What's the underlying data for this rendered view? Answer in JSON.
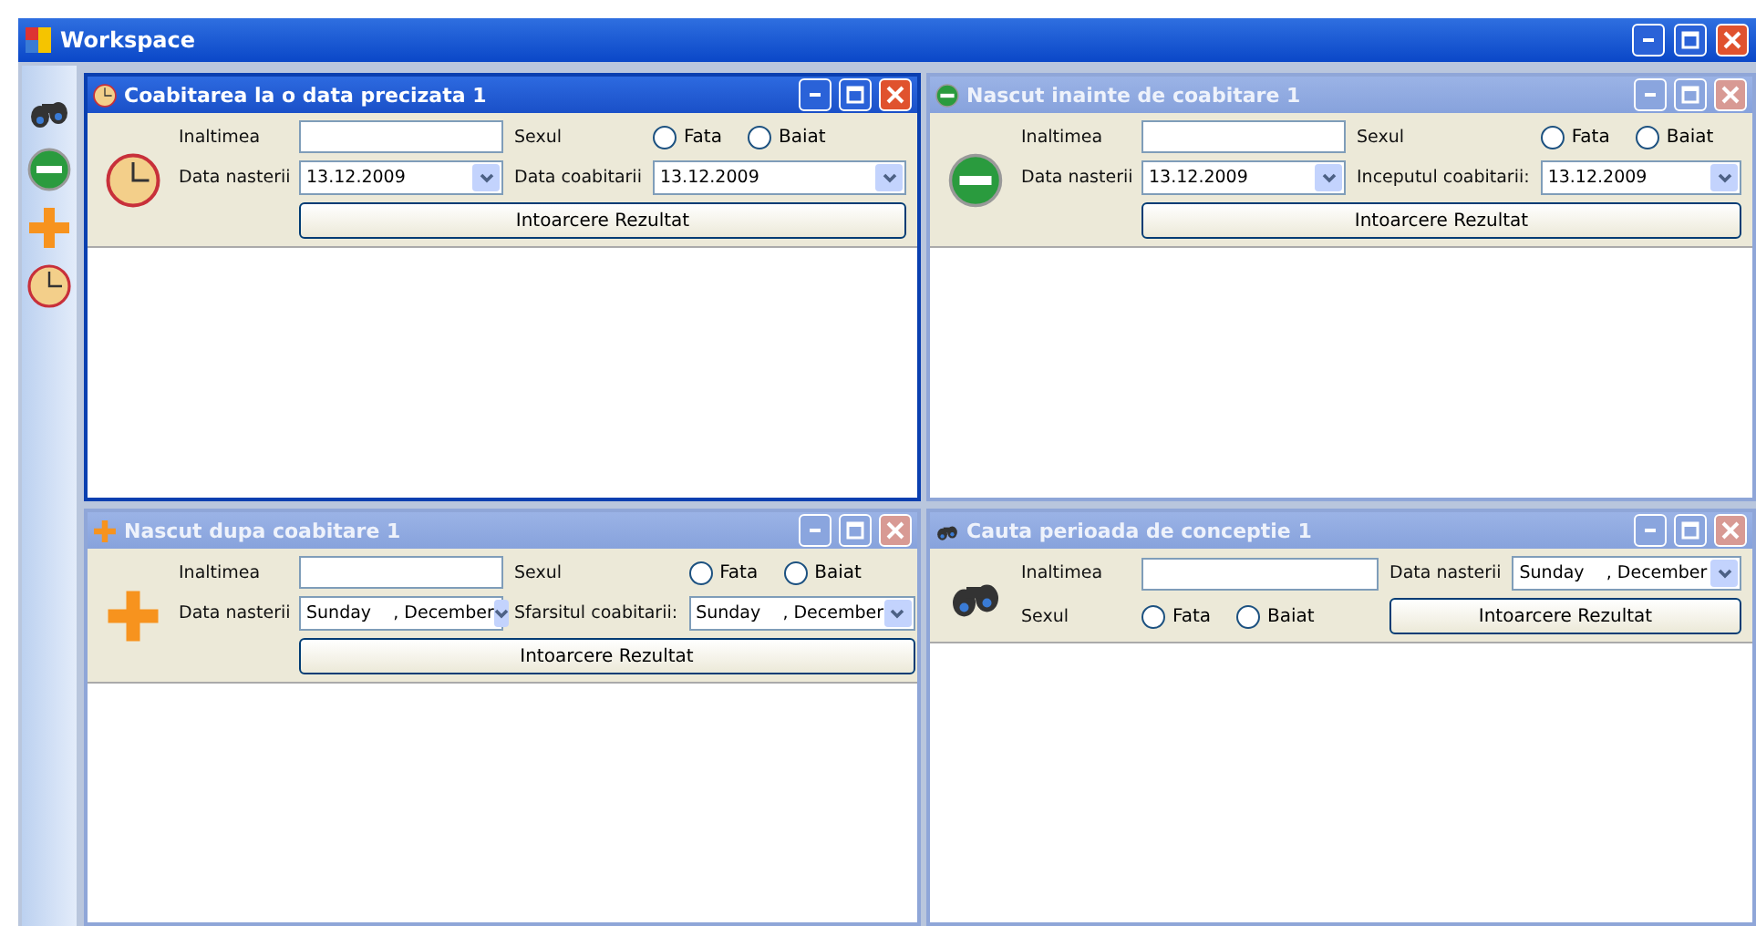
{
  "window": {
    "title": "Workspace"
  },
  "toolbar": [
    {
      "kind": "tool"
    },
    {
      "kind": "tool"
    },
    {
      "kind": "tool"
    },
    {
      "kind": "tool"
    }
  ],
  "children": [
    {
      "title": "Coabitarea la o data precizata 1",
      "active": true,
      "fields": [
        {
          "kind": "label",
          "text": "Inaltimea"
        },
        {
          "kind": "text"
        },
        {
          "kind": "label",
          "text": "Sexul"
        },
        {
          "kind": "radios",
          "options": [
            {
              "label": "Fata",
              "selected": false
            },
            {
              "label": "Baiat",
              "selected": false
            }
          ]
        },
        {
          "kind": "label",
          "text": "Data nasterii"
        },
        {
          "kind": "date",
          "value": "13.12.2009"
        },
        {
          "kind": "label",
          "text": "Data coabitarii"
        },
        {
          "kind": "date",
          "value": "13.12.2009"
        },
        {
          "kind": "button",
          "text": "Intoarcere Rezultat"
        }
      ]
    },
    {
      "title": "Nascut inainte de coabitare 1",
      "active": false,
      "fields": [
        {
          "kind": "label",
          "text": "Inaltimea"
        },
        {
          "kind": "text"
        },
        {
          "kind": "label",
          "text": "Sexul"
        },
        {
          "kind": "radios",
          "options": [
            {
              "label": "Fata",
              "selected": false
            },
            {
              "label": "Baiat",
              "selected": false
            }
          ]
        },
        {
          "kind": "label",
          "text": "Data nasterii"
        },
        {
          "kind": "date",
          "value": "13.12.2009"
        },
        {
          "kind": "label",
          "text": "Inceputul coabitarii:"
        },
        {
          "kind": "date",
          "value": "13.12.2009"
        },
        {
          "kind": "button",
          "text": "Intoarcere Rezultat"
        }
      ]
    },
    {
      "title": "Nascut dupa coabitare 1",
      "active": false,
      "fields": [
        {
          "kind": "label",
          "text": "Inaltimea"
        },
        {
          "kind": "text"
        },
        {
          "kind": "label",
          "text": "Sexul"
        },
        {
          "kind": "radios",
          "options": [
            {
              "label": "Fata",
              "selected": false
            },
            {
              "label": "Baiat",
              "selected": false
            }
          ]
        },
        {
          "kind": "label",
          "text": "Data nasterii"
        },
        {
          "kind": "date",
          "value": "Sunday    , December"
        },
        {
          "kind": "label",
          "text": "Sfarsitul coabitarii:"
        },
        {
          "kind": "date",
          "value": "Sunday    , December"
        },
        {
          "kind": "button",
          "text": "Intoarcere Rezultat"
        }
      ]
    },
    {
      "title": "Cauta perioada de conceptie 1",
      "active": false,
      "fields": [
        {
          "kind": "label",
          "text": "Inaltimea"
        },
        {
          "kind": "text"
        },
        {
          "kind": "label",
          "text": "Data nasterii"
        },
        {
          "kind": "date",
          "value": "Sunday    , December"
        },
        {
          "kind": "label",
          "text": "Sexul"
        },
        {
          "kind": "radios",
          "options": [
            {
              "label": "Fata",
              "selected": false
            },
            {
              "label": "Baiat",
              "selected": false
            }
          ]
        },
        {
          "kind": "button",
          "text": "Intoarcere Rezultat"
        }
      ]
    }
  ]
}
